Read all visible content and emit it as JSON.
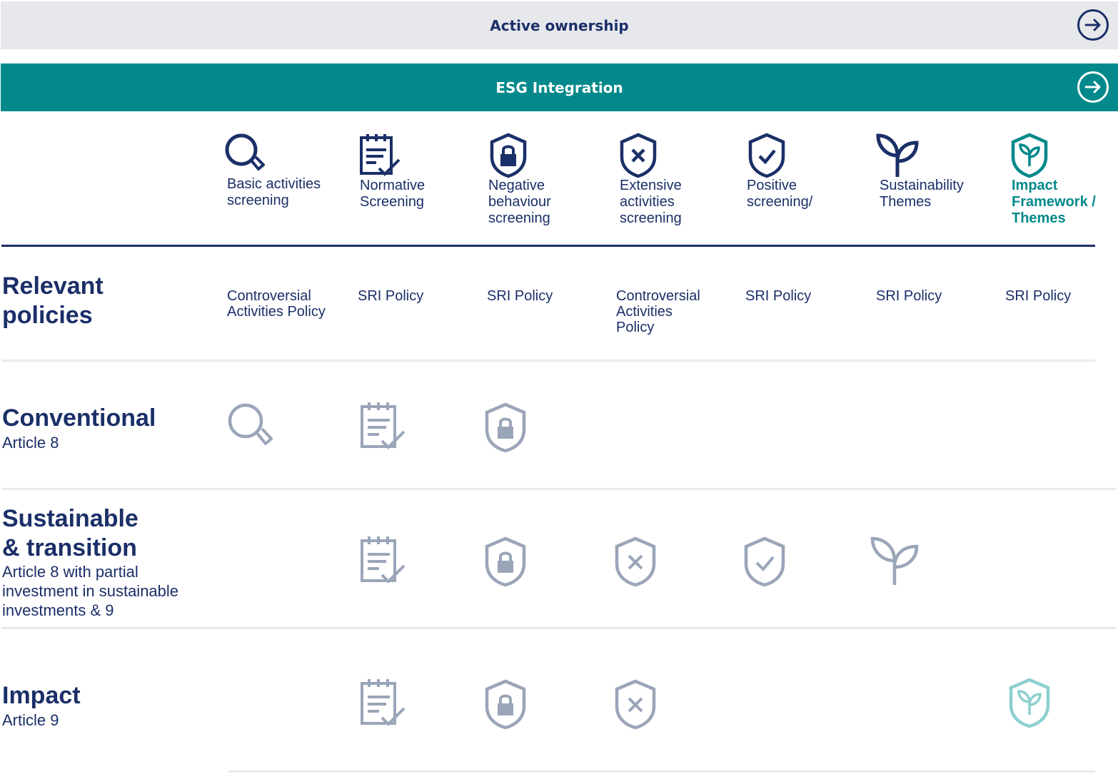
{
  "header_bars": [
    {
      "label": "Active ownership",
      "arrow_icon": "arrow-right-circle-icon"
    },
    {
      "label": "ESG Integration",
      "arrow_icon": "arrow-right-circle-icon"
    }
  ],
  "columns": [
    {
      "icon": "magnifier-icon",
      "label": "Basic activities\nscreening",
      "policy": "Controversial\nActivities Policy"
    },
    {
      "icon": "checklist-icon",
      "label": "Normative\nScreening",
      "policy": "SRI Policy"
    },
    {
      "icon": "shield-lock-icon",
      "label": "Negative\nbehaviour\nscreening",
      "policy": "SRI Policy"
    },
    {
      "icon": "shield-x-icon",
      "label": "Extensive\nactivities\nscreening",
      "policy": "Controversial\nActivities\nPolicy"
    },
    {
      "icon": "shield-check-icon",
      "label": "Positive\nscreening/",
      "policy": "SRI Policy"
    },
    {
      "icon": "sprout-icon",
      "label": "Sustainability\nThemes",
      "policy": "SRI Policy"
    },
    {
      "icon": "shield-sprout-icon",
      "label": "Impact\nFramework /\nThemes",
      "policy": "SRI Policy"
    }
  ],
  "rows": [
    {
      "title": "Relevant\npolicies"
    },
    {
      "title": "Conventional",
      "subtitle": "Article 8",
      "applies": [
        true,
        true,
        true,
        false,
        false,
        false,
        false
      ]
    },
    {
      "title": "Sustainable\n& transition",
      "subtitle": "Article 8 with partial\ninvestment in sustainable\ninvestments & 9",
      "applies": [
        false,
        true,
        true,
        true,
        true,
        true,
        false
      ]
    },
    {
      "title": "Impact",
      "subtitle": "Article 9",
      "applies": [
        false,
        true,
        true,
        true,
        false,
        false,
        true
      ]
    }
  ],
  "colors": {
    "navy": "#1b2f68",
    "teal": "#03898b",
    "muted_icon": "#9aa5b8",
    "muted_teal": "#8fcfcf",
    "bar_grey": "#e6e8ec"
  }
}
